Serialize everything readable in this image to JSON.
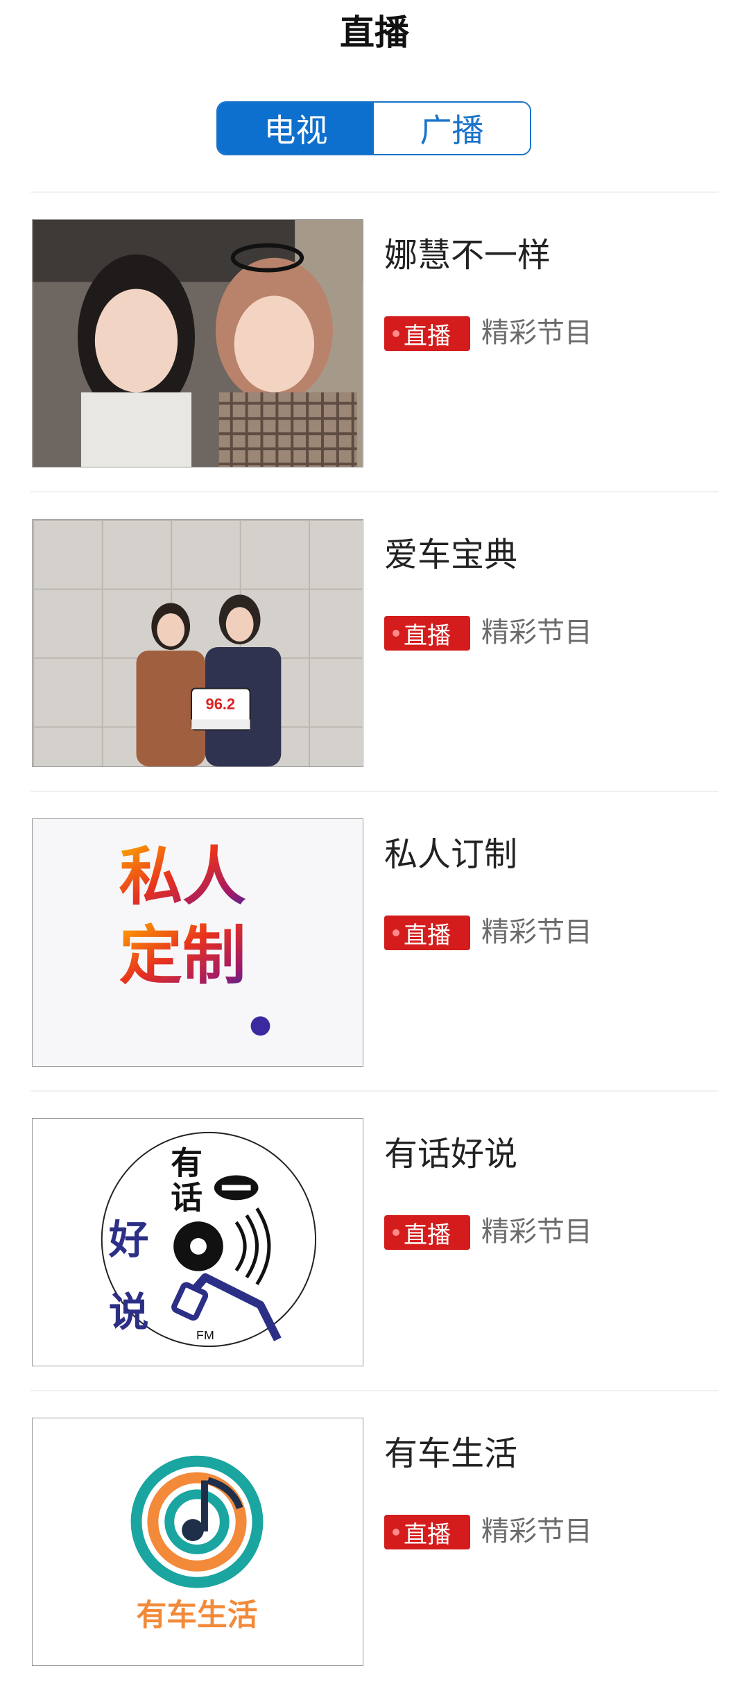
{
  "header": {
    "title": "直播"
  },
  "tabs": [
    {
      "label": "电视",
      "active": true
    },
    {
      "label": "广播",
      "active": false
    }
  ],
  "colors": {
    "accent_blue": "#0d6fce",
    "live_red": "#d41c1c",
    "subtitle_gray": "#6b6b6b"
  },
  "programs": [
    {
      "title": "娜慧不一样",
      "badge": "直播",
      "subtitle": "精彩节目",
      "thumb_icon": "hosts-photo"
    },
    {
      "title": "爱车宝典",
      "badge": "直播",
      "subtitle": "精彩节目",
      "thumb_icon": "hosts-photo",
      "thumb_text": "96.2"
    },
    {
      "title": "私人订制",
      "badge": "直播",
      "subtitle": "精彩节目",
      "thumb_icon": "program-logo",
      "thumb_text": "私人定制"
    },
    {
      "title": "有话好说",
      "badge": "直播",
      "subtitle": "精彩节目",
      "thumb_icon": "program-logo",
      "thumb_text": "FM"
    },
    {
      "title": "有车生活",
      "badge": "直播",
      "subtitle": "精彩节目",
      "thumb_icon": "program-logo",
      "thumb_text": "有车生活"
    }
  ]
}
